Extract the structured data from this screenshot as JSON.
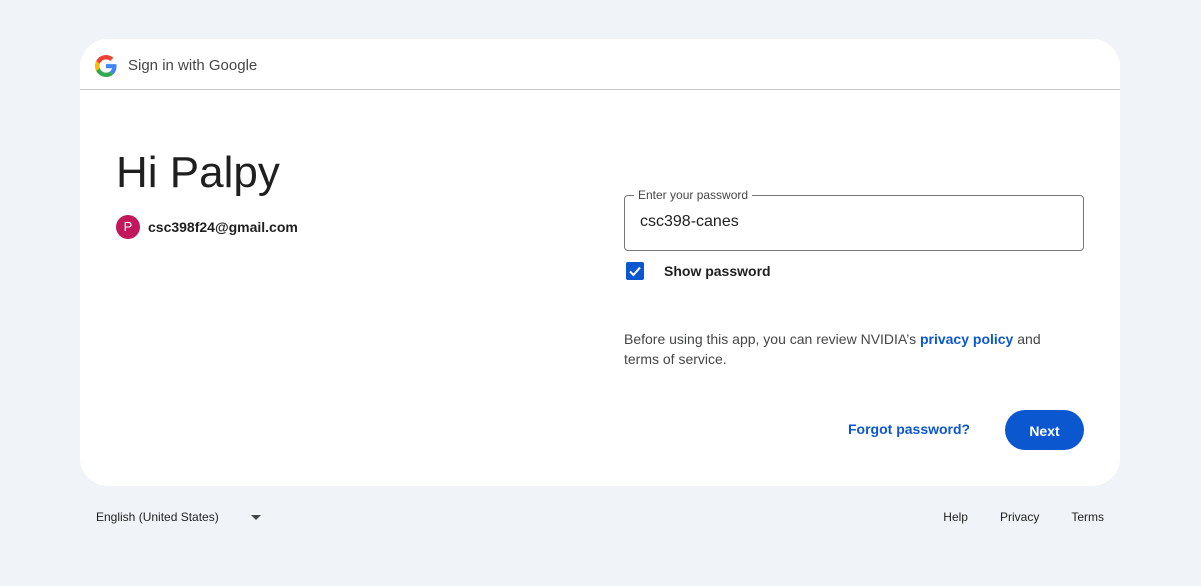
{
  "header": {
    "title": "Sign in with Google"
  },
  "greeting": "Hi Palpy",
  "account": {
    "avatar_letter": "P",
    "avatar_color": "#c2185b",
    "email": "csc398f24@gmail.com"
  },
  "password_field": {
    "label": "Enter your password",
    "value": "csc398-canes"
  },
  "show_password": {
    "label": "Show password",
    "checked": true
  },
  "notice": {
    "text_before": "Before using this app, you can review NVIDIA’s ",
    "privacy_link": "privacy policy",
    "text_after": " and terms of service."
  },
  "actions": {
    "forgot_label": "Forgot password?",
    "next_label": "Next"
  },
  "footer": {
    "language": "English (United States)",
    "links": [
      "Help",
      "Privacy",
      "Terms"
    ]
  },
  "colors": {
    "accent": "#0b57d0",
    "background": "#f0f4f9"
  }
}
